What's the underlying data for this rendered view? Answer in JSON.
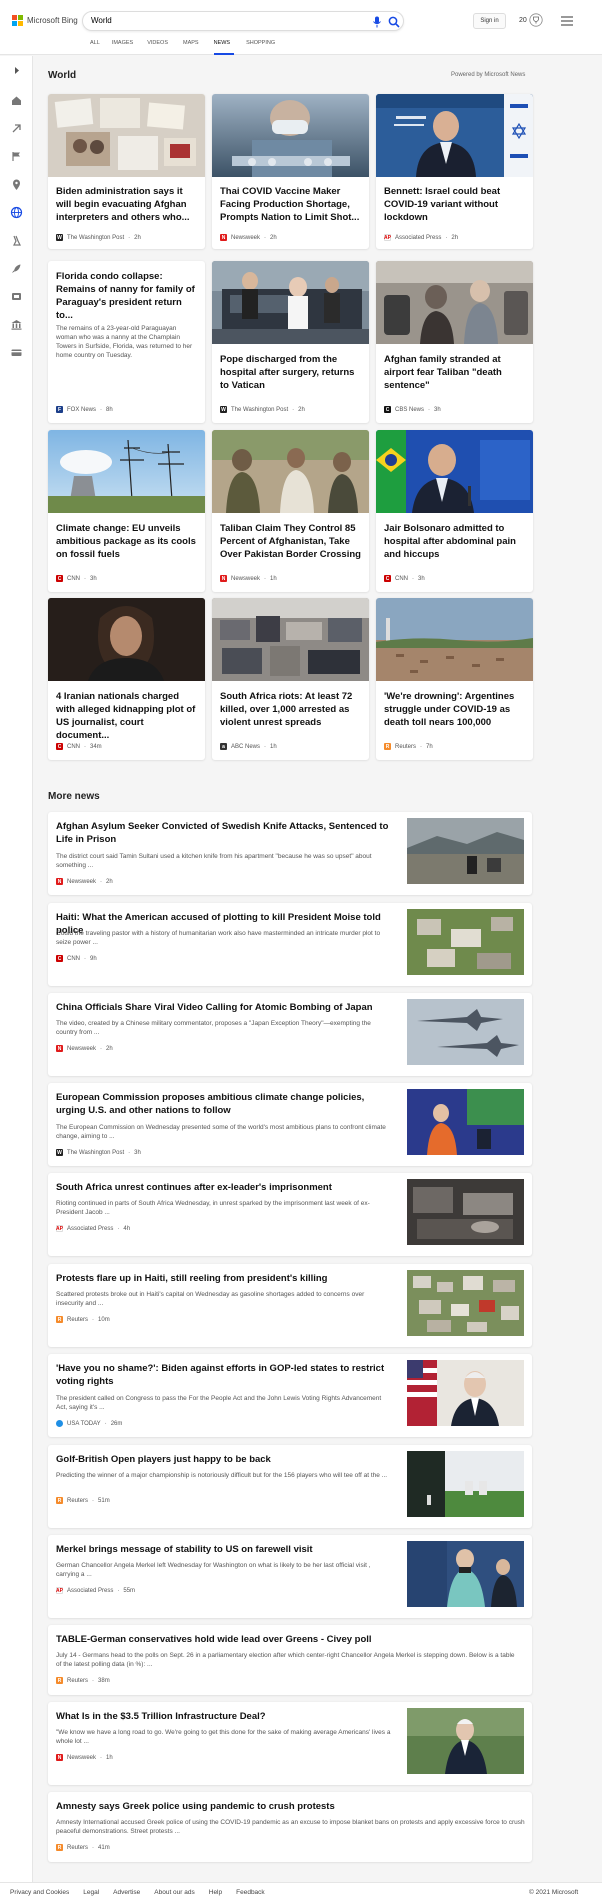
{
  "brand": {
    "name": "Microsoft Bing"
  },
  "search": {
    "query": "World"
  },
  "header": {
    "signin_label": "Sign in",
    "rewards_count": "20"
  },
  "tabs": [
    {
      "label": "ALL"
    },
    {
      "label": "IMAGES"
    },
    {
      "label": "VIDEOS"
    },
    {
      "label": "MAPS"
    },
    {
      "label": "NEWS"
    },
    {
      "label": "SHOPPING"
    }
  ],
  "section": {
    "title": "World",
    "powered_by": "Powered by Microsoft News"
  },
  "cards": [
    {
      "title": "Biden administration says it will begin evacuating Afghan interpreters and others who...",
      "source": "The Washington Post",
      "age": "2h",
      "icon": "washington-post-logo"
    },
    {
      "title": "Thai COVID Vaccine Maker Facing Production Shortage, Prompts Nation to Limit Shot...",
      "source": "Newsweek",
      "age": "2h",
      "icon": "newsweek-logo"
    },
    {
      "title": "Bennett: Israel could beat COVID-19 variant without lockdown",
      "source": "Associated Press",
      "age": "2h",
      "icon": "ap-logo"
    },
    {
      "title": "Florida condo collapse: Remains of nanny for family of Paraguay's president return to...",
      "snippet": "The remains of a 23-year-old Paraguayan woman who was a nanny at the Champlain Towers in Surfside, Florida, was returned to her home country on Tuesday.",
      "source": "FOX News",
      "age": "8h",
      "icon": "fox-news-logo"
    },
    {
      "title": "Pope discharged from the hospital after surgery, returns to Vatican",
      "source": "The Washington Post",
      "age": "2h",
      "icon": "washington-post-logo"
    },
    {
      "title": "Afghan family stranded at airport fear Taliban \"death sentence\"",
      "source": "CBS News",
      "age": "3h",
      "icon": "cbs-logo"
    },
    {
      "title": "Climate change: EU unveils ambitious package as its cools on fossil fuels",
      "source": "CNN",
      "age": "3h",
      "icon": "cnn-logo"
    },
    {
      "title": "Taliban Claim They Control 85 Percent of Afghanistan, Take Over Pakistan Border Crossing",
      "source": "Newsweek",
      "age": "1h",
      "icon": "newsweek-logo"
    },
    {
      "title": "Jair Bolsonaro admitted to hospital after abdominal pain and hiccups",
      "source": "CNN",
      "age": "3h",
      "icon": "cnn-logo"
    },
    {
      "title": "4 Iranian nationals charged with alleged kidnapping plot of US journalist, court document...",
      "source": "CNN",
      "age": "34m",
      "icon": "cnn-logo"
    },
    {
      "title": "South Africa riots: At least 72 killed, over 1,000 arrested as violent unrest spreads",
      "source": "ABC News",
      "age": "1h",
      "icon": "abc-logo"
    },
    {
      "title": "'We're drowning': Argentines struggle under COVID-19 as death toll nears 100,000",
      "source": "Reuters",
      "age": "7h",
      "icon": "reuters-logo"
    }
  ],
  "more_news": {
    "title": "More news",
    "items": [
      {
        "title": "Afghan Asylum Seeker Convicted of Swedish Knife Attacks, Sentenced to Life in Prison",
        "snippet": "The district court said Tamin Sultani used a kitchen knife from his apartment \"because he was so upset\" about something ...",
        "source": "Newsweek",
        "age": "2h",
        "icon": "newsweek-logo"
      },
      {
        "title": "Haiti: What the American accused of plotting to kill President Moise told police",
        "snippet": "Could the traveling pastor with a history of humanitarian work also have masterminded an intricate murder plot to seize power ...",
        "source": "CNN",
        "age": "9h",
        "icon": "cnn-logo"
      },
      {
        "title": "China Officials Share Viral Video Calling for Atomic Bombing of Japan",
        "snippet": "The video, created by a Chinese military commentator, proposes a \"Japan Exception Theory\"—exempting the country from ...",
        "source": "Newsweek",
        "age": "2h",
        "icon": "newsweek-logo"
      },
      {
        "title": "European Commission proposes ambitious climate change policies, urging U.S. and other nations to follow",
        "snippet": "The European Commission on Wednesday presented some of the world's most ambitious plans to confront climate change, aiming to ...",
        "source": "The Washington Post",
        "age": "3h",
        "icon": "washington-post-logo"
      },
      {
        "title": "South Africa unrest continues after ex-leader's imprisonment",
        "snippet": "Rioting continued in parts of South Africa Wednesday, in unrest sparked by the imprisonment last week of ex-President Jacob ...",
        "source": "Associated Press",
        "age": "4h",
        "icon": "ap-logo"
      },
      {
        "title": "Protests flare up in Haiti, still reeling from president's killing",
        "snippet": "Scattered protests broke out in Haiti's capital on Wednesday as gasoline shortages added to concerns over insecurity and ...",
        "source": "Reuters",
        "age": "10m",
        "icon": "reuters-logo"
      },
      {
        "title": "'Have you no shame?': Biden against efforts in GOP-led states to restrict voting rights",
        "snippet": "The president called on Congress to pass the For the People Act and the John Lewis Voting Rights Advancement Act, saying it's ...",
        "source": "USA TODAY",
        "age": "26m",
        "icon": "usa-today-logo"
      },
      {
        "title": "Golf-British Open players just happy to be back",
        "snippet": "Predicting the winner of a major championship is notoriously difficult but for the 156 players who will tee off at the ...",
        "source": "Reuters",
        "age": "51m",
        "icon": "reuters-logo"
      },
      {
        "title": "Merkel brings message of stability to US on farewell visit",
        "snippet": "German Chancellor Angela Merkel left Wednesday for Washington on what is likely to be her last official visit , carrying a ...",
        "source": "Associated Press",
        "age": "55m",
        "icon": "ap-logo"
      },
      {
        "title": "TABLE-German conservatives hold wide lead over Greens - Civey poll",
        "snippet": "July 14 - Germans head to the polls on Sept. 26 in a parliamentary election after which center-right Chancellor Angela Merkel is stepping down. Below is a table of the latest polling data (in %): ...",
        "source": "Reuters",
        "age": "38m",
        "icon": "reuters-logo"
      },
      {
        "title": "What Is in the $3.5 Trillion Infrastructure Deal?",
        "snippet": "\"We know we have a long road to go. We're going to get this done for the sake of making average Americans' lives a whole lot ...",
        "source": "Newsweek",
        "age": "1h",
        "icon": "newsweek-logo"
      },
      {
        "title": "Amnesty says Greek police using pandemic to crush protests",
        "snippet": "Amnesty International accused Greek police of using the COVID-19 pandemic as an excuse to impose blanket bans on protests and apply excessive force to crush peaceful demonstrations. Street protests ...",
        "source": "Reuters",
        "age": "41m",
        "icon": "reuters-logo"
      }
    ]
  },
  "footer": {
    "links": [
      {
        "label": "Privacy and Cookies"
      },
      {
        "label": "Legal"
      },
      {
        "label": "Advertise"
      },
      {
        "label": "About our ads"
      },
      {
        "label": "Help"
      },
      {
        "label": "Feedback"
      }
    ],
    "copyright": "© 2021 Microsoft"
  },
  "colors": {
    "accent": "#174ae4",
    "ms_red": "#f25022",
    "ms_green": "#7fba00",
    "ms_blue": "#00a4ef",
    "ms_yellow": "#ffb900"
  }
}
